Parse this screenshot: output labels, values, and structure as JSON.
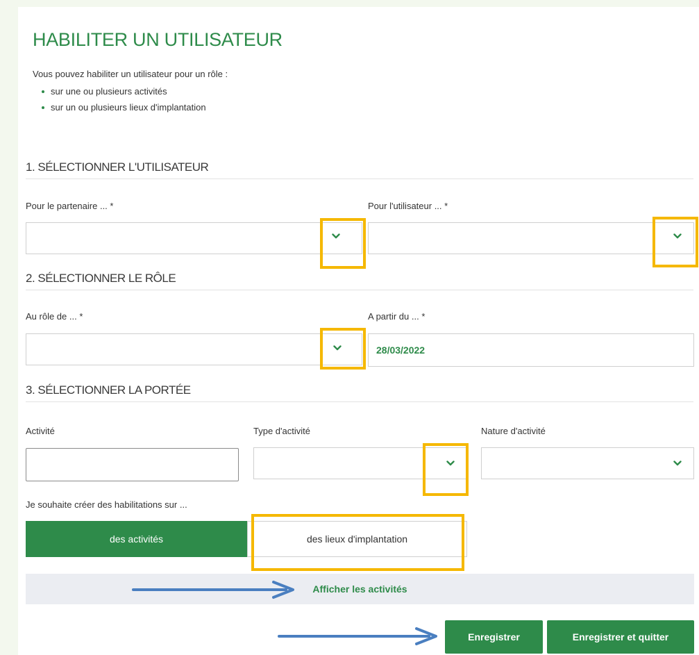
{
  "page": {
    "title": "HABILITER UN UTILISATEUR",
    "intro": "Vous pouvez habiliter un utilisateur pour un rôle :",
    "bullets": [
      "sur une ou plusieurs activités",
      "sur un ou plusieurs lieux d'implantation"
    ]
  },
  "section1": {
    "title": "1. SÉLECTIONNER L'UTILISATEUR",
    "partner_label": "Pour le partenaire ... *",
    "partner_value": "",
    "user_label": "Pour l'utilisateur ... *",
    "user_value": ""
  },
  "section2": {
    "title": "2. SÉLECTIONNER LE RÔLE",
    "role_label": "Au rôle de ... *",
    "role_value": "",
    "date_label": "A partir du ... *",
    "date_value": "28/03/2022"
  },
  "section3": {
    "title": "3. SÉLECTIONNER LA PORTÉE",
    "activity_label": "Activité",
    "activity_value": "",
    "type_label": "Type d'activité",
    "type_value": "",
    "nature_label": "Nature d'activité",
    "nature_value": "",
    "habilitation_label": "Je souhaite créer des habilitations sur ...",
    "toggle_activities": "des activités",
    "toggle_locations": "des lieux d'implantation",
    "show_link": "Afficher les activités"
  },
  "actions": {
    "save": "Enregistrer",
    "save_quit": "Enregistrer et quitter"
  },
  "colors": {
    "brand_green": "#2e8b4a",
    "highlight": "#f5b800",
    "arrow": "#4a7fc0"
  },
  "icons": {
    "dropdown": "chevron-down-icon",
    "annotation": "arrow-right-icon"
  }
}
